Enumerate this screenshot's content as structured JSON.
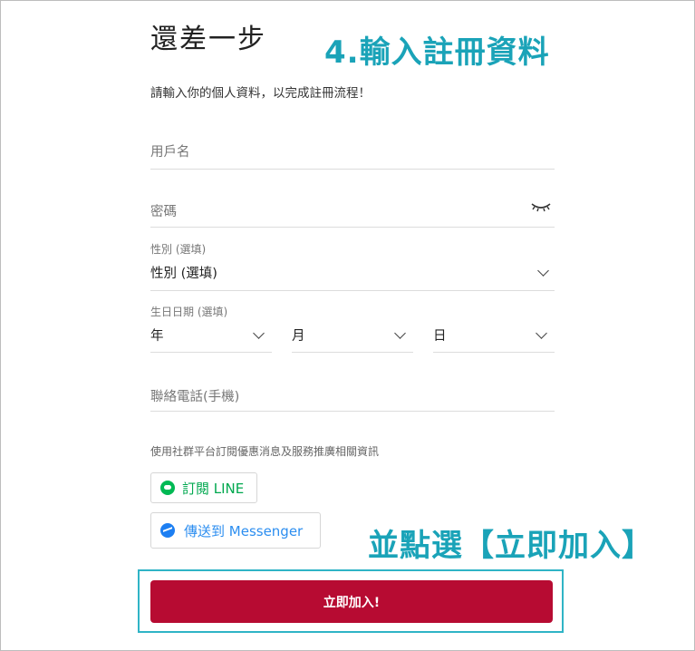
{
  "header": {
    "title": "還差一步",
    "subtitle": "請輸入你的個人資料，以完成註冊流程！"
  },
  "annotations": {
    "step": "4.輸入註冊資料",
    "action": "並點選【立即加入】"
  },
  "form": {
    "username_placeholder": "用戶名",
    "password_placeholder": "密碼",
    "gender_label": "性別 (選填)",
    "gender_value": "性別 (選填)",
    "birthday_label": "生日日期 (選填)",
    "year": "年",
    "month": "月",
    "day": "日",
    "phone_placeholder": "聯絡電話(手機)"
  },
  "social": {
    "note": "使用社群平台訂閱優惠消息及服務推廣相關資訊",
    "line_label": "訂閱 LINE",
    "messenger_label": "傳送到 Messenger"
  },
  "submit": {
    "label": "立即加入!"
  },
  "colors": {
    "accent_annotation": "#1aa3b8",
    "submit": "#b70b32",
    "line": "#00a84f",
    "messenger": "#2c8ef0"
  }
}
